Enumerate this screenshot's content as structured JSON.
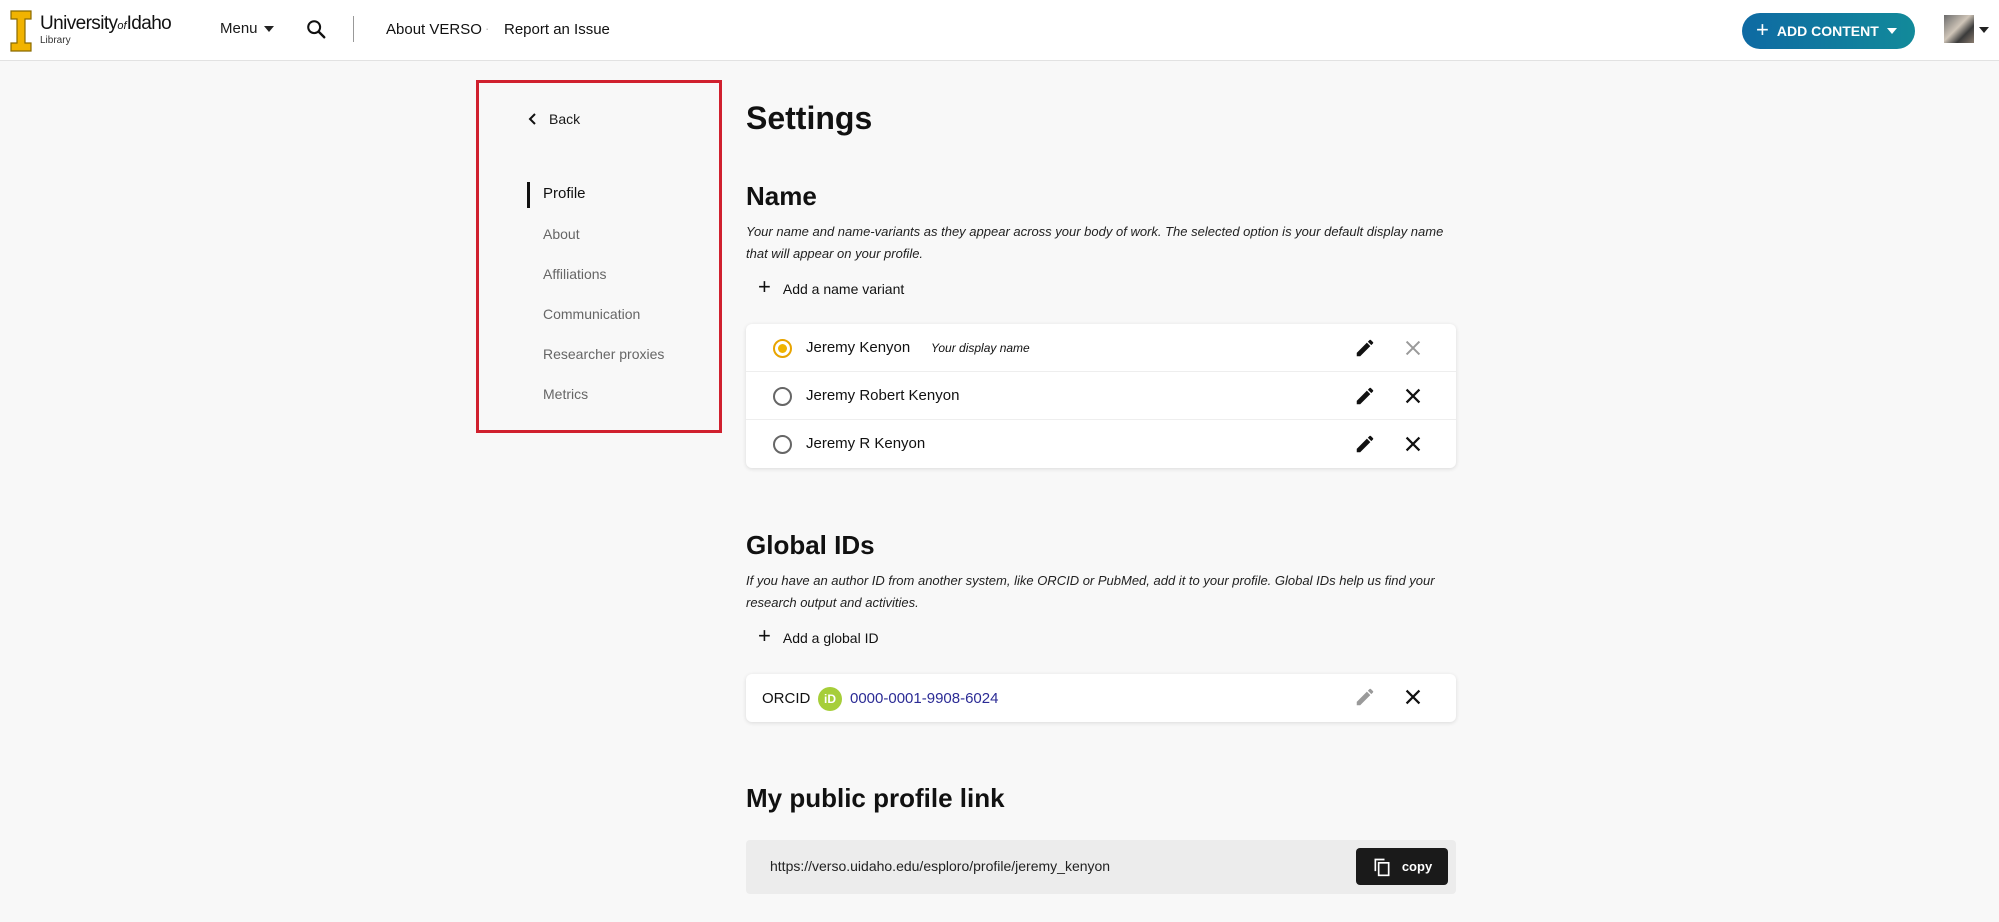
{
  "header": {
    "logo": {
      "university": "University",
      "of": "of",
      "idaho": "Idaho",
      "sub": "Library"
    },
    "menu_label": "Menu",
    "links": [
      "About VERSO",
      "Report an Issue"
    ],
    "separator": "·",
    "add_content_label": "ADD CONTENT",
    "accent_color": "#0e6aa3"
  },
  "sidebar": {
    "back_label": "Back",
    "items": [
      {
        "label": "Profile",
        "active": true
      },
      {
        "label": "About",
        "active": false
      },
      {
        "label": "Affiliations",
        "active": false
      },
      {
        "label": "Communication",
        "active": false
      },
      {
        "label": "Researcher proxies",
        "active": false
      },
      {
        "label": "Metrics",
        "active": false
      }
    ],
    "highlight_color": "#d0202e"
  },
  "main": {
    "title": "Settings",
    "name_section": {
      "title": "Name",
      "description": "Your name and name-variants as they appear across your body of work. The selected option is your default display name that will appear on your profile.",
      "add_label": "Add a name variant",
      "names": [
        {
          "name": "Jeremy Kenyon",
          "selected": true,
          "tag": "Your display name"
        },
        {
          "name": "Jeremy Robert Kenyon",
          "selected": false
        },
        {
          "name": "Jeremy R Kenyon",
          "selected": false
        }
      ]
    },
    "global_ids": {
      "title": "Global IDs",
      "description": "If you have an author ID from another system, like ORCID or PubMed, add it to your profile. Global IDs help us find your research output and activities.",
      "add_label": "Add a global ID",
      "orcid_label": "ORCID",
      "orcid_icon_text": "iD",
      "orcid_value": "0000-0001-9908-6024",
      "orcid_color": "#a6ce39"
    },
    "public_link": {
      "title": "My public profile link",
      "url": "https://verso.uidaho.edu/esploro/profile/jeremy_kenyon",
      "copy_label": "copy"
    }
  }
}
